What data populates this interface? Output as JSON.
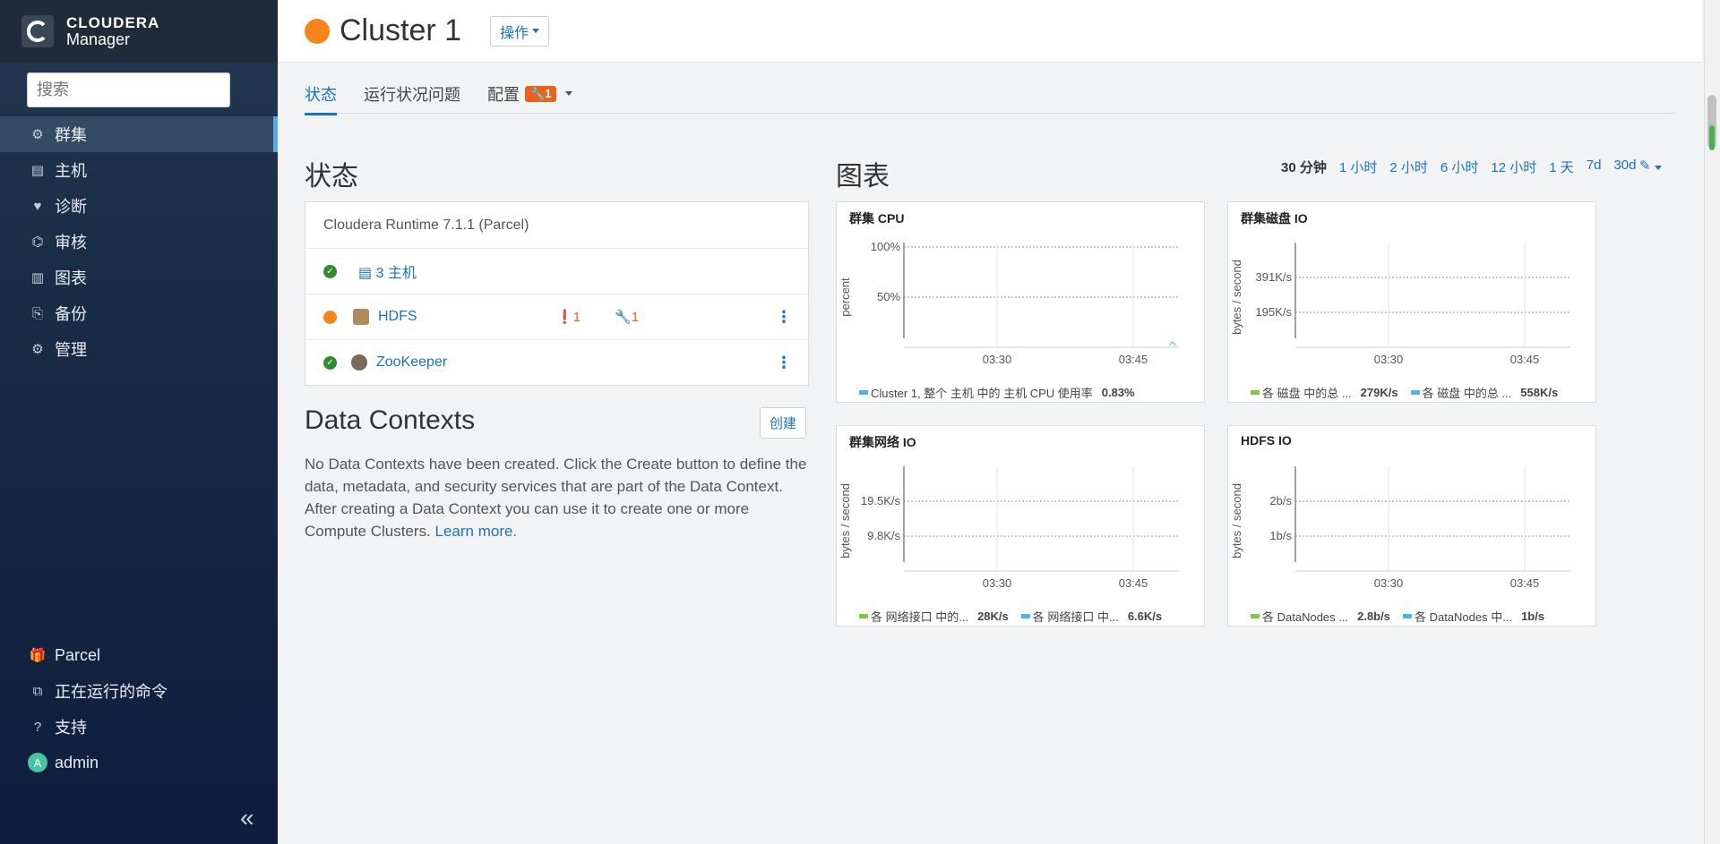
{
  "brand": {
    "line1": "CLOUDERA",
    "line2": "Manager"
  },
  "search": {
    "placeholder": "搜索"
  },
  "nav": [
    {
      "label": "群集",
      "icon": "clusters-icon",
      "active": true
    },
    {
      "label": "主机",
      "icon": "hosts-icon"
    },
    {
      "label": "诊断",
      "icon": "heartbeat-icon"
    },
    {
      "label": "审核",
      "icon": "binoculars-icon"
    },
    {
      "label": "图表",
      "icon": "bar-chart-icon"
    },
    {
      "label": "备份",
      "icon": "backup-icon"
    },
    {
      "label": "管理",
      "icon": "gear-icon"
    }
  ],
  "nav_bottom": [
    {
      "label": "Parcel",
      "icon": "gift-icon"
    },
    {
      "label": "正在运行的命令",
      "icon": "running-commands-icon"
    },
    {
      "label": "支持",
      "icon": "help-icon"
    },
    {
      "label": "admin",
      "icon": "avatar-icon",
      "avatar": "A"
    }
  ],
  "header": {
    "title": "Cluster 1",
    "actions": "操作"
  },
  "tabs": {
    "status": "状态",
    "health": "运行状况问题",
    "config": "配置",
    "config_badge": "1"
  },
  "status": {
    "heading": "状态",
    "runtime": "Cloudera Runtime 7.1.1 (Parcel)",
    "hosts": "3 主机",
    "services": [
      {
        "name": "HDFS",
        "alerts": "1",
        "config": "1"
      },
      {
        "name": "ZooKeeper"
      }
    ]
  },
  "data_contexts": {
    "heading": "Data Contexts",
    "create": "创建",
    "text": "No Data Contexts have been created. Click the Create button to define the data, metadata, and security services that are part of the Data Context. After creating a Data Context you can use it to create one or more Compute Clusters. ",
    "learn_more": "Learn more."
  },
  "charts": {
    "heading": "图表",
    "ranges": [
      "30 分钟",
      "1 小时",
      "2 小时",
      "6 小时",
      "12 小时",
      "1 天",
      "7d",
      "30d"
    ]
  },
  "colors": {
    "accent": "#1a73c2",
    "warning": "#f7851b",
    "ok": "#2e8b2e",
    "series_green": "#8bc34a",
    "series_blue": "#4fb3e8"
  },
  "chart_data": [
    {
      "type": "line",
      "title": "群集 CPU",
      "ylabel": "percent",
      "yticks": [
        "100%",
        "50%"
      ],
      "xticks": [
        "03:30",
        "03:45"
      ],
      "series": [
        {
          "name": "Cluster 1, 整个 主机 中的 主机 CPU 使用率",
          "value": "0.83%"
        }
      ]
    },
    {
      "type": "line",
      "title": "群集磁盘 IO",
      "ylabel": "bytes / second",
      "yticks": [
        "391K/s",
        "195K/s"
      ],
      "xticks": [
        "03:30",
        "03:45"
      ],
      "series": [
        {
          "name": "各 磁盘 中的总 ...",
          "value": "279K/s"
        },
        {
          "name": "各 磁盘 中的总 ...",
          "value": "558K/s"
        }
      ]
    },
    {
      "type": "line",
      "title": "群集网络 IO",
      "ylabel": "bytes / second",
      "yticks": [
        "19.5K/s",
        "9.8K/s"
      ],
      "xticks": [
        "03:30",
        "03:45"
      ],
      "series": [
        {
          "name": "各 网络接口 中的...",
          "value": "28K/s"
        },
        {
          "name": "各 网络接口 中...",
          "value": "6.6K/s"
        }
      ]
    },
    {
      "type": "line",
      "title": "HDFS IO",
      "ylabel": "bytes / second",
      "yticks": [
        "2b/s",
        "1b/s"
      ],
      "xticks": [
        "03:30",
        "03:45"
      ],
      "series": [
        {
          "name": "各 DataNodes ...",
          "value": "2.8b/s"
        },
        {
          "name": "各 DataNodes 中...",
          "value": "1b/s"
        }
      ]
    }
  ]
}
